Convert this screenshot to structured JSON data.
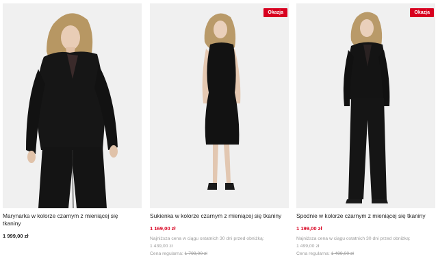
{
  "products": [
    {
      "title": "Marynarka w kolorze czarnym z mieniącej się tkaniny",
      "price": "1 999,00 zł"
    },
    {
      "badge": "Okazja",
      "title": "Sukienka w kolorze czarnym z mieniącej się tkaniny",
      "price": "1 169,00 zł",
      "lowest_label": "Najniższa cena w ciągu ostatnich 30 dni przed obniżką:",
      "lowest_value": "1 439,00 zł",
      "regular_label": "Cena regularna:",
      "regular_value": "1 799,00 zł"
    },
    {
      "badge": "Okazja",
      "title": "Spodnie w kolorze czarnym z mieniącej się tkaniny",
      "price": "1 199,00 zł",
      "lowest_label": "Najniższa cena w ciągu ostatnich 30 dni przed obniżką:",
      "lowest_value": "1 499,00 zł",
      "regular_label": "Cena regularna:",
      "regular_value": "1 499,00 zł"
    }
  ],
  "colors": {
    "sale_red": "#d8001f",
    "muted_text": "#9a9a9a",
    "photo_bg": "#f0f0f0"
  }
}
